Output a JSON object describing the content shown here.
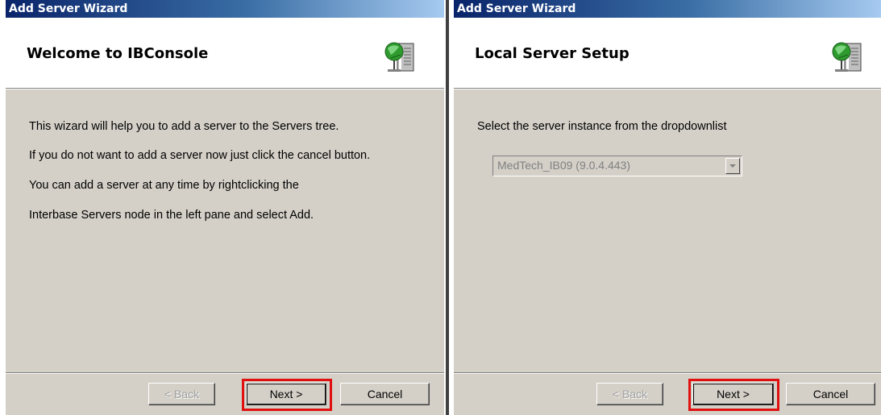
{
  "left_dialog": {
    "window_title": "Add Server Wizard",
    "header_title": "Welcome to IBConsole",
    "body_lines": [
      "This wizard will help you to add a server to the Servers tree.",
      "If you do not want to add a server now just click the cancel button.",
      "You can add a server at any time by rightclicking the",
      "Interbase Servers node in the left pane and select Add."
    ],
    "buttons": {
      "back": "< Back",
      "next": "Next >",
      "cancel": "Cancel"
    }
  },
  "right_dialog": {
    "window_title": "Add Server Wizard",
    "header_title": "Local Server Setup",
    "instruction": "Select the server instance from the dropdownlist",
    "server_instance": {
      "selected": "MedTech_IB09 (9.0.4.443)",
      "enabled": false
    },
    "buttons": {
      "back": "< Back",
      "next": "Next >",
      "cancel": "Cancel"
    }
  },
  "colors": {
    "title_bar_start": "#0a246a",
    "title_bar_end": "#a6caf0",
    "dialog_face": "#d4d0c8",
    "highlight_box": "#e01010"
  },
  "icons": {
    "header_icon": "server-globe-icon",
    "dropdown_arrow": "chevron-down-icon"
  }
}
